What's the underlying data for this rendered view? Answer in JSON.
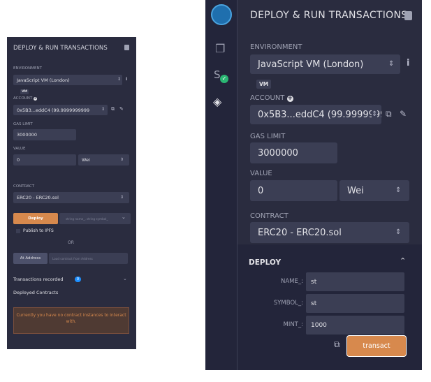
{
  "left_panel": {
    "title": "DEPLOY & RUN TRANSACTIONS",
    "environment_label": "ENVIRONMENT",
    "environment_value": "JavaScript VM (London)",
    "vm_badge": "VM",
    "account_label": "ACCOUNT",
    "account_value": "0x5B3...eddC4 (99.9999999999",
    "gas_limit_label": "GAS LIMIT",
    "gas_limit_value": "3000000",
    "value_label": "VALUE",
    "value_amount": "0",
    "value_unit": "Wei",
    "contract_label": "CONTRACT",
    "contract_value": "ERC20 - ERC20.sol",
    "deploy_button": "Deploy",
    "deploy_params_hint": "string name_, string symbol_",
    "publish_ipfs": "Publish to IPFS",
    "or_text": "OR",
    "at_address_button": "At Address",
    "at_address_hint": "Load contract from Address",
    "transactions_recorded": "Transactions recorded",
    "transactions_count": "0",
    "deployed_contracts": "Deployed Contracts",
    "no_contract_msg": "Currently you have no contract instances to interact with."
  },
  "right_panel": {
    "title": "DEPLOY & RUN TRANSACTIONS",
    "environment_label": "ENVIRONMENT",
    "environment_value": "JavaScript VM (London)",
    "vm_badge": "VM",
    "account_label": "ACCOUNT",
    "account_value": "0x5B3...eddC4 (99.9999999999",
    "gas_limit_label": "GAS LIMIT",
    "gas_limit_value": "3000000",
    "value_label": "VALUE",
    "value_amount": "0",
    "value_unit": "Wei",
    "contract_label": "CONTRACT",
    "contract_value": "ERC20 - ERC20.sol",
    "deploy_section_title": "DEPLOY",
    "params": [
      {
        "label": "NAME_:",
        "value": "st"
      },
      {
        "label": "SYMBOL_:",
        "value": "st"
      },
      {
        "label": "MINT_:",
        "value": "1000"
      }
    ],
    "transact_button": "transact"
  },
  "icons": {
    "sidebar": [
      "remix-logo-icon",
      "file-explorer-icon",
      "solidity-compiler-icon",
      "deploy-run-icon"
    ],
    "accent_colors": {
      "orange": "#d7894d",
      "green": "#2bb673",
      "blue": "#1e90ff"
    }
  }
}
